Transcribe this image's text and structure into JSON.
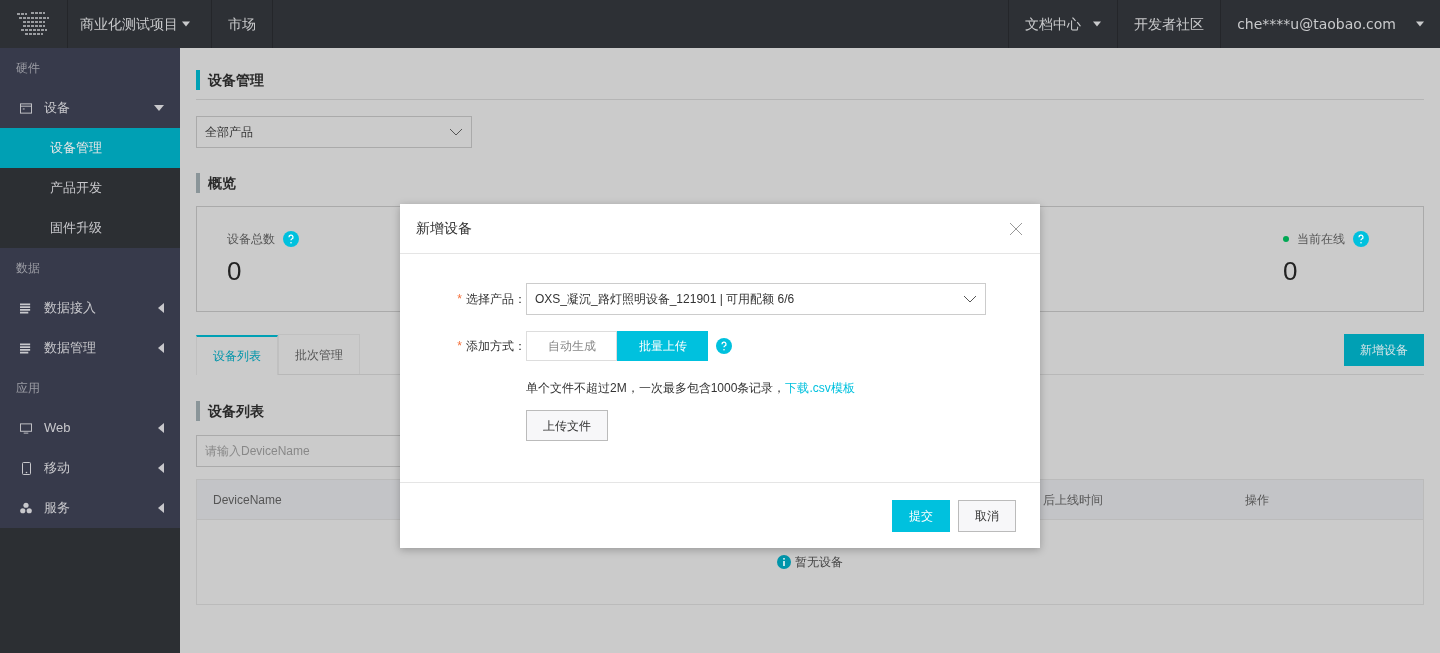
{
  "topbar": {
    "project": "商业化测试项目",
    "nav": [
      "市场"
    ],
    "right": [
      {
        "label": "文档中心",
        "dropdown": true
      },
      {
        "label": "开发者社区",
        "dropdown": false
      }
    ],
    "user": "che****u@taobao.com"
  },
  "sidebar": [
    {
      "title": "硬件",
      "items": [
        {
          "label": "设备",
          "kind": "window",
          "expanded": true,
          "children": [
            {
              "label": "设备管理",
              "selected": true
            },
            {
              "label": "产品开发",
              "selected": false
            },
            {
              "label": "固件升级",
              "selected": false
            }
          ]
        }
      ]
    },
    {
      "title": "数据",
      "items": [
        {
          "label": "数据接入",
          "kind": "list",
          "expanded": false
        },
        {
          "label": "数据管理",
          "kind": "list",
          "expanded": false
        }
      ]
    },
    {
      "title": "应用",
      "items": [
        {
          "label": "Web",
          "kind": "monitor",
          "expanded": false
        },
        {
          "label": "移动",
          "kind": "mobile",
          "expanded": false
        },
        {
          "label": "服务",
          "kind": "cluster",
          "expanded": false
        }
      ]
    }
  ],
  "content": {
    "page_title": "设备管理",
    "product_filter": "全部产品",
    "overview_title": "概览",
    "stats": [
      {
        "label": "设备总数",
        "value": "0"
      },
      {
        "label": "当前在线",
        "value": "0",
        "color": "#00a854"
      }
    ],
    "tabs": [
      {
        "label": "设备列表",
        "selected": true
      },
      {
        "label": "批次管理",
        "selected": false
      }
    ],
    "add_button": "新增设备",
    "list_title": "设备列表",
    "search": {
      "placeholder": "请输入DeviceName"
    },
    "table": {
      "columns": [
        "DeviceName",
        "后上线时间",
        "操作"
      ],
      "empty": "暂无设备"
    }
  },
  "modal": {
    "title": "新增设备",
    "product": {
      "label": "选择产品：",
      "required_mark": "*",
      "value": "OXS_凝沉_路灯照明设备_121901 | 可用配额 6/6"
    },
    "method": {
      "label": "添加方式：",
      "required_mark": "*",
      "options": [
        {
          "label": "自动生成",
          "selected": false
        },
        {
          "label": "批量上传",
          "selected": true
        }
      ]
    },
    "hint": "单个文件不超过2M，一次最多包含1000条记录，",
    "hint_link": "下载.csv模板",
    "upload_button": "上传文件",
    "submit": "提交",
    "cancel": "取消"
  }
}
